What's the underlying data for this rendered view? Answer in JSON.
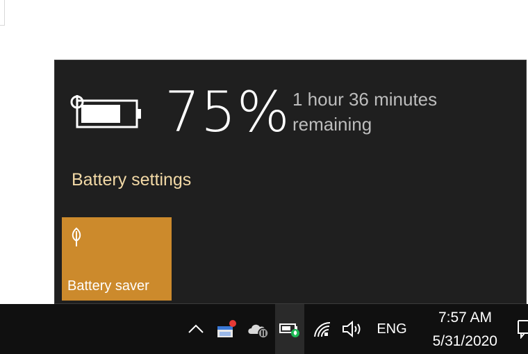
{
  "battery_flyout": {
    "percent": "75%",
    "remaining_line1": "1 hour 36 minutes",
    "remaining_line2": "remaining",
    "settings_link": "Battery settings",
    "saver_tile_label": "Battery saver",
    "battery_level": 0.75
  },
  "taskbar": {
    "language": "ENG",
    "time": "7:57 AM",
    "date": "5/31/2020",
    "icons": [
      "chevron-up-icon",
      "app-notification-icon",
      "onedrive-paused-icon",
      "battery-saver-icon",
      "wifi-icon",
      "volume-icon",
      "notification-center-icon"
    ]
  },
  "colors": {
    "flyout_bg": "#1f1f1f",
    "accent_tile": "#cc8a2c",
    "link_text": "#f2d9a6",
    "taskbar_bg": "#101010"
  }
}
